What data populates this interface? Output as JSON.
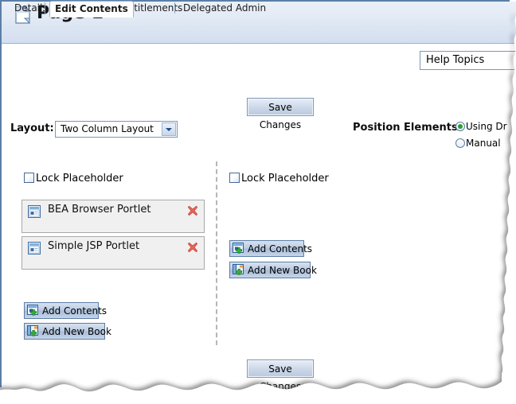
{
  "header": {
    "title": "Page 1",
    "icon": "page-document-icon"
  },
  "tabs": [
    {
      "label": "Details",
      "active": false
    },
    {
      "label": "Edit Contents",
      "active": true
    },
    {
      "label": "Entitlements",
      "active": false
    },
    {
      "label": "Delegated Admin",
      "active": false
    }
  ],
  "help": {
    "label": "Help Topics"
  },
  "toolbar": {
    "save_label": "Save Changes"
  },
  "layout": {
    "label": "Layout:",
    "selected": "Two Column Layout",
    "options": [
      "Two Column Layout"
    ]
  },
  "position": {
    "label": "Position Elements:",
    "options": [
      {
        "label": "Using Dr",
        "selected": true
      },
      {
        "label": "Manual",
        "selected": false
      }
    ]
  },
  "columns": {
    "left": {
      "lock_label": "Lock Placeholder",
      "lock_checked": false,
      "portlets": [
        {
          "label": "BEA Browser Portlet",
          "icon": "portlet-window-icon",
          "delete_icon": "delete-x-icon"
        },
        {
          "label": "Simple JSP Portlet",
          "icon": "portlet-window-icon",
          "delete_icon": "delete-x-icon"
        }
      ],
      "add_contents_label": "Add Contents",
      "add_book_label": "Add New Book"
    },
    "right": {
      "lock_label": "Lock Placeholder",
      "lock_checked": false,
      "portlets": [],
      "add_contents_label": "Add Contents",
      "add_book_label": "Add New Book"
    }
  },
  "colors": {
    "header_gradient_top": "#eaf0f8",
    "header_gradient_bottom": "#dbe5f2",
    "frame_border": "#5b7fa6",
    "tab_border": "#9bb1cc",
    "portlet_bg": "#f0f0f0",
    "portlet_border": "#a9a9a9",
    "delete_icon": "#e8655a",
    "radio_selected": "#2f9c2f",
    "divider_dashed": "#b6b6b6",
    "button_border": "#5c7da6"
  }
}
